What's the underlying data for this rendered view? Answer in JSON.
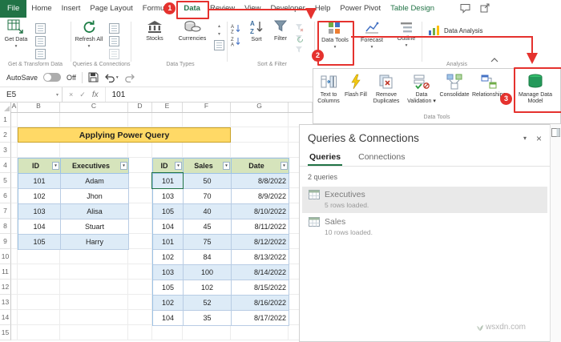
{
  "colors": {
    "excel_green": "#217346",
    "annotation_red": "#e5322e",
    "title_fill": "#ffd966",
    "table_header_fill": "#d6e4bc",
    "band_fill": "#ddebf7",
    "table_border": "#9bc2e6"
  },
  "menubar": {
    "tabs": [
      "File",
      "Home",
      "Insert",
      "Page Layout",
      "Formulas",
      "Data",
      "Review",
      "View",
      "Developer",
      "Help",
      "Power Pivot",
      "Table Design"
    ]
  },
  "quick_access": {
    "autosave_label": "AutoSave",
    "autosave_state": "Off"
  },
  "ribbon": {
    "get_data_label": "Get Data",
    "refresh_all_label": "Refresh All",
    "stocks_label": "Stocks",
    "currencies_label": "Currencies",
    "sort_label": "Sort",
    "filter_label": "Filter",
    "data_tools_label": "Data Tools",
    "forecast_label": "Forecast",
    "outline_label": "Outline",
    "data_analysis_label": "Data Analysis",
    "group_labels": {
      "get_transform": "Get & Transform Data",
      "queries_connections": "Queries & Connections",
      "data_types": "Data Types",
      "sort_filter": "Sort & Filter",
      "analysis": "Analysis"
    }
  },
  "data_tools_panel": {
    "group_label": "Data Tools",
    "items": [
      {
        "label": "Text to Columns"
      },
      {
        "label": "Flash Fill"
      },
      {
        "label": "Remove Duplicates"
      },
      {
        "label": "Data Validation",
        "dropdown": true
      },
      {
        "label": "Consolidate"
      },
      {
        "label": "Relationships"
      },
      {
        "label": "Manage Data Model"
      }
    ]
  },
  "formula_bar": {
    "name_box": "E5",
    "fx": "fx",
    "value": "101"
  },
  "sheet": {
    "column_letters": [
      "A",
      "B",
      "C",
      "D",
      "E",
      "F",
      "G"
    ],
    "visible_rows": 15,
    "title_cell": "Applying Power Query",
    "executives_table": {
      "headers": [
        "ID",
        "Executives"
      ],
      "rows": [
        [
          "101",
          "Adam"
        ],
        [
          "102",
          "Jhon"
        ],
        [
          "103",
          "Alisa"
        ],
        [
          "104",
          "Stuart"
        ],
        [
          "105",
          "Harry"
        ]
      ]
    },
    "sales_table": {
      "headers": [
        "ID",
        "Sales",
        "Date"
      ],
      "rows": [
        [
          "101",
          "50",
          "8/8/2022"
        ],
        [
          "103",
          "70",
          "8/9/2022"
        ],
        [
          "105",
          "40",
          "8/10/2022"
        ],
        [
          "104",
          "45",
          "8/11/2022"
        ],
        [
          "101",
          "75",
          "8/12/2022"
        ],
        [
          "102",
          "84",
          "8/13/2022"
        ],
        [
          "103",
          "100",
          "8/14/2022"
        ],
        [
          "105",
          "102",
          "8/15/2022"
        ],
        [
          "102",
          "52",
          "8/16/2022"
        ],
        [
          "104",
          "35",
          "8/17/2022"
        ]
      ]
    }
  },
  "queries_pane": {
    "title": "Queries & Connections",
    "tabs": [
      {
        "label": "Queries",
        "active": true
      },
      {
        "label": "Connections",
        "active": false
      }
    ],
    "count_text": "2 queries",
    "items": [
      {
        "name": "Executives",
        "detail": "5 rows loaded.",
        "selected": true
      },
      {
        "name": "Sales",
        "detail": "10 rows loaded.",
        "selected": false
      }
    ]
  },
  "annotations": {
    "step1": "1",
    "step2": "2",
    "step3": "3"
  },
  "watermark": "wsxdn.com"
}
